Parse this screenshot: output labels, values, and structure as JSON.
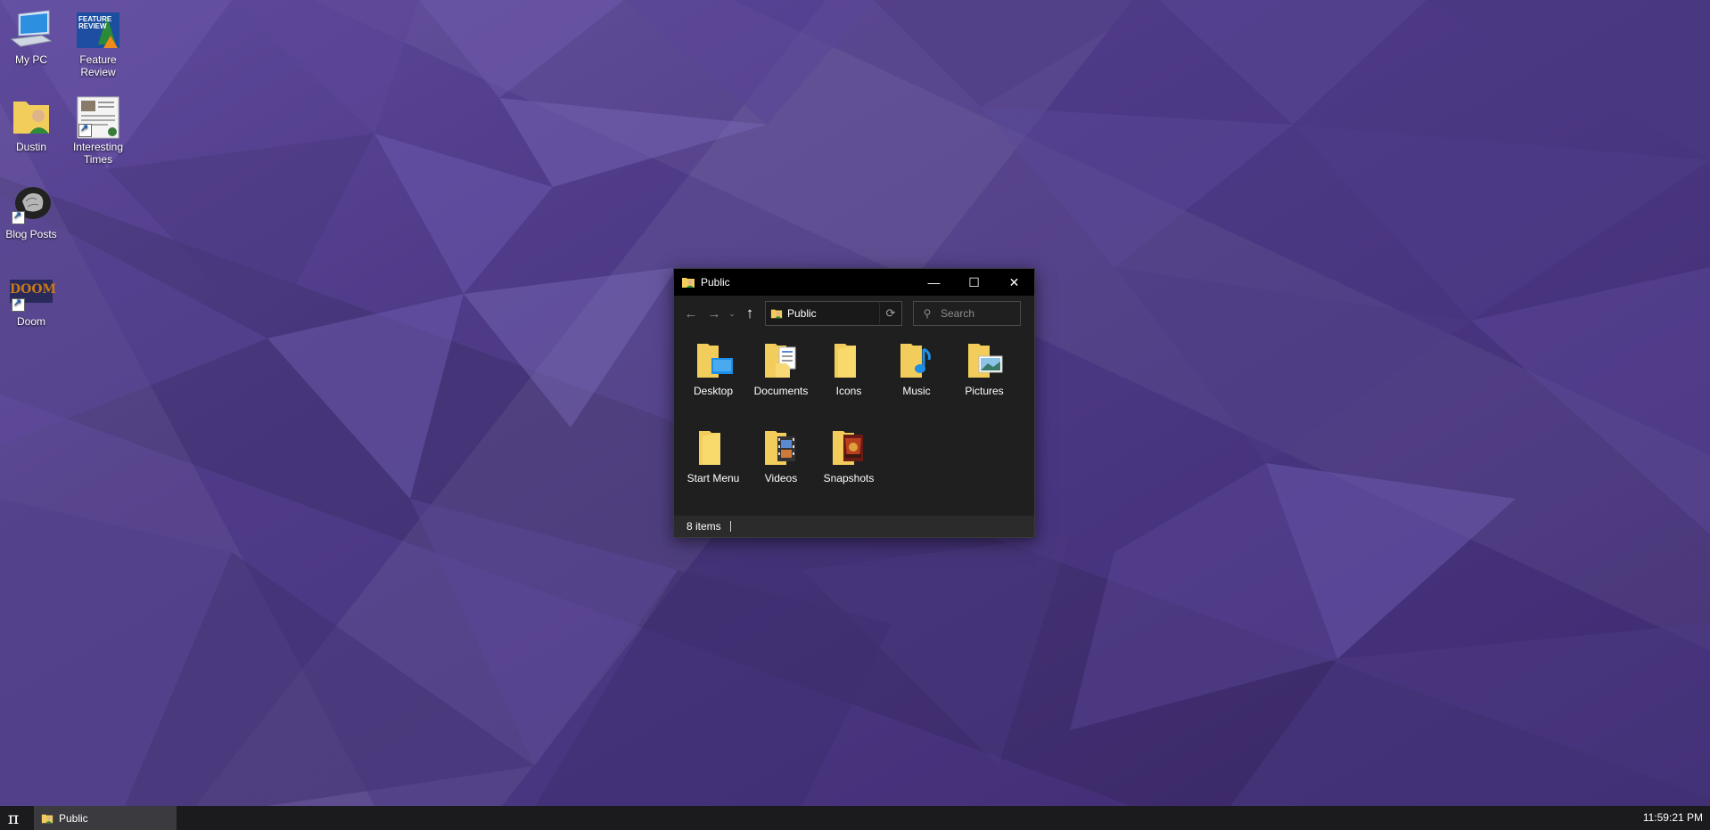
{
  "desktop": {
    "icons": [
      {
        "label": "My PC"
      },
      {
        "label": "Feature Review"
      },
      {
        "label": "Dustin"
      },
      {
        "label": "Interesting Times"
      },
      {
        "label": "Blog Posts"
      },
      {
        "label": "Doom"
      }
    ],
    "feature_review_thumb_text": "FEATURE REVIEW",
    "doom_logo_text": "DOOM"
  },
  "window": {
    "title": "Public",
    "address": "Public",
    "search_placeholder": "Search",
    "items": [
      {
        "label": "Desktop",
        "icon": "folder-desktop-icon"
      },
      {
        "label": "Documents",
        "icon": "folder-documents-icon"
      },
      {
        "label": "Icons",
        "icon": "folder-icon"
      },
      {
        "label": "Music",
        "icon": "folder-music-icon"
      },
      {
        "label": "Pictures",
        "icon": "folder-pictures-icon"
      },
      {
        "label": "Start Menu",
        "icon": "folder-icon"
      },
      {
        "label": "Videos",
        "icon": "folder-videos-icon"
      },
      {
        "label": "Snapshots",
        "icon": "folder-snapshots-icon"
      }
    ],
    "status_count": "8 items"
  },
  "taskbar": {
    "start_glyph": "π",
    "task_label": "Public",
    "clock": "11:59:21 PM"
  },
  "colors": {
    "wallpaper": "#4a3782",
    "folder": "#f3cd5b",
    "taskbar": "#1b1b1e",
    "window_bg": "#1f1f1f"
  }
}
